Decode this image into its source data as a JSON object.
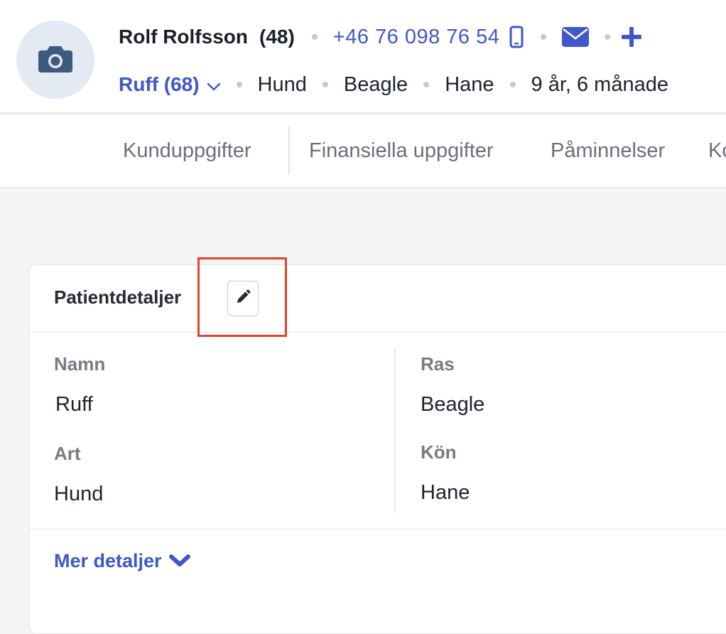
{
  "header": {
    "owner_name": "Rolf Rolfsson",
    "owner_id": "(48)",
    "phone": "+46 76 098 76 54",
    "patient_link": "Ruff (68)",
    "species": "Hund",
    "breed": "Beagle",
    "sex": "Hane",
    "age": "9 år, 6 månade",
    "icons": [
      "camera-icon",
      "mobile-phone-icon",
      "envelope-icon",
      "plus-icon",
      "chevron-down-icon"
    ]
  },
  "tabs": [
    {
      "label": "Kunduppgifter"
    },
    {
      "label": "Finansiella uppgifter"
    },
    {
      "label": "Påminnelser"
    },
    {
      "label": "Ko"
    }
  ],
  "card": {
    "title": "Patientdetaljer",
    "fields": {
      "name_label": "Namn",
      "name_value": "Ruff",
      "species_label": "Art",
      "species_value": "Hund",
      "breed_label": "Ras",
      "breed_value": "Beagle",
      "sex_label": "Kön",
      "sex_value": "Hane"
    },
    "more_details": "Mer detaljer"
  },
  "colors": {
    "accent": "#3f57c9",
    "highlight": "#e5432d",
    "avatar_bg": "#e3eaf3",
    "camera": "#3d5a80"
  }
}
